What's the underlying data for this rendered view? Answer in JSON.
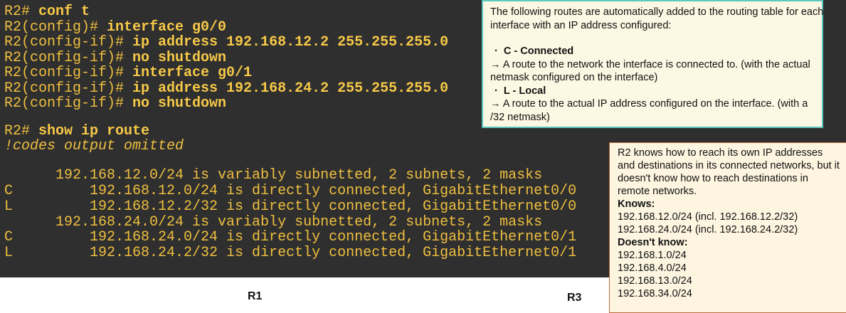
{
  "terminal": {
    "config_lines": [
      {
        "prompt": "R2# ",
        "cmd": "conf t"
      },
      {
        "prompt": "R2(config)# ",
        "cmd": "interface g0/0"
      },
      {
        "prompt": "R2(config-if)# ",
        "cmd": "ip address 192.168.12.2 255.255.255.0"
      },
      {
        "prompt": "R2(config-if)# ",
        "cmd": "no shutdown"
      },
      {
        "prompt": "R2(config-if)# ",
        "cmd": "interface g0/1"
      },
      {
        "prompt": "R2(config-if)# ",
        "cmd": "ip address 192.168.24.2 255.255.255.0"
      },
      {
        "prompt": "R2(config-if)# ",
        "cmd": "no shutdown"
      }
    ],
    "show_prompt": "R2# ",
    "show_cmd": "show ip route",
    "comment": "!codes output omitted",
    "route_lines": [
      "      192.168.12.0/24 is variably subnetted, 2 subnets, 2 masks",
      "C         192.168.12.0/24 is directly connected, GigabitEthernet0/0",
      "L         192.168.12.2/32 is directly connected, GigabitEthernet0/0",
      "      192.168.24.0/24 is variably subnetted, 2 subnets, 2 masks",
      "C         192.168.24.0/24 is directly connected, GigabitEthernet0/1",
      "L         192.168.24.2/32 is directly connected, GigabitEthernet0/1"
    ]
  },
  "info_box": {
    "intro": "The following routes are automatically added to the routing table for each interface with an IP address configured:",
    "c_title": "C - Connected",
    "c_desc": "→  A route to the network the interface is connected to. (with the actual netmask configured on the interface)",
    "l_title": "L - Local",
    "l_desc": "→ A route to the actual IP address configured on the interface. (with a /32 netmask)"
  },
  "knows_box": {
    "intro": "R2 knows how to reach its own IP addresses and destinations in its connected networks, but it doesn't know how to reach destinations in remote networks.",
    "knows_title": "Knows:",
    "knows": [
      "192.168.12.0/24 (incl. 192.168.12.2/32)",
      "192.168.24.0/24 (incl. 192.168.24.2/32)"
    ],
    "doesnt_title": "Doesn't know:",
    "doesnt": [
      "192.168.1.0/24",
      "192.168.4.0/24",
      "192.168.13.0/24",
      "192.168.34.0/24"
    ]
  },
  "diagram": {
    "r1": "R1",
    "r3": "R3"
  }
}
